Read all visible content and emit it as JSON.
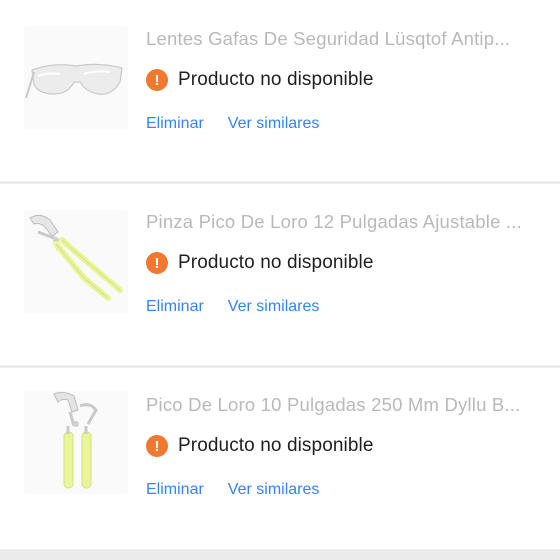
{
  "items": [
    {
      "title": "Lentes Gafas De Seguridad Lüsqtof Antip...",
      "thumbnail_icon": "safety-glasses-icon",
      "status_icon": "exclamation-icon",
      "status": "Producto no disponible",
      "remove_label": "Eliminar",
      "similar_label": "Ver similares"
    },
    {
      "title": "Pinza Pico De Loro 12 Pulgadas Ajustable ...",
      "thumbnail_icon": "pliers-icon",
      "status_icon": "exclamation-icon",
      "status": "Producto no disponible",
      "remove_label": "Eliminar",
      "similar_label": "Ver similares"
    },
    {
      "title": "Pico De Loro 10 Pulgadas 250 Mm Dyllu B...",
      "thumbnail_icon": "pliers-icon",
      "status_icon": "exclamation-icon",
      "status": "Producto no disponible",
      "remove_label": "Eliminar",
      "similar_label": "Ver similares"
    }
  ],
  "colors": {
    "title_disabled": "#b9b9b9",
    "warning": "#f0792f",
    "link": "#3483fa",
    "separator": "#ebebeb"
  }
}
